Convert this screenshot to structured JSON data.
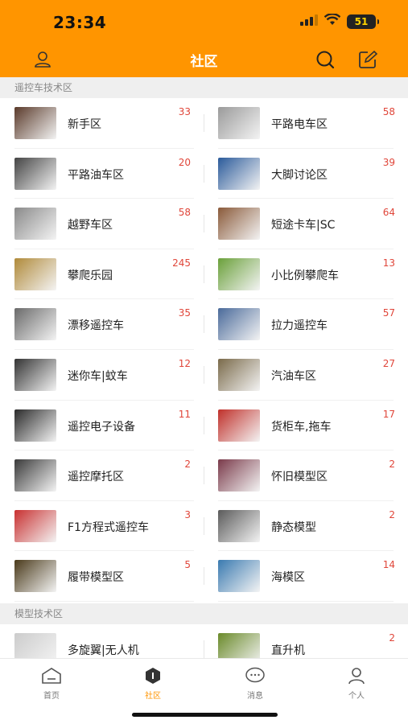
{
  "status_bar": {
    "time": "23:34",
    "battery": "51"
  },
  "nav": {
    "title": "社区"
  },
  "sections": [
    {
      "title": "遥控车技术区",
      "items": [
        {
          "label": "新手区",
          "count": "33",
          "thumb": "#5a3a2a"
        },
        {
          "label": "平路电车区",
          "count": "58",
          "thumb": "#9a9a9a"
        },
        {
          "label": "平路油车区",
          "count": "20",
          "thumb": "#444444"
        },
        {
          "label": "大脚讨论区",
          "count": "39",
          "thumb": "#2a5a9a"
        },
        {
          "label": "越野车区",
          "count": "58",
          "thumb": "#8a8a8a"
        },
        {
          "label": "短途卡车|SC",
          "count": "64",
          "thumb": "#8a5a3a"
        },
        {
          "label": "攀爬乐园",
          "count": "245",
          "thumb": "#b08a3a"
        },
        {
          "label": "小比例攀爬车",
          "count": "13",
          "thumb": "#6aa03a"
        },
        {
          "label": "漂移遥控车",
          "count": "35",
          "thumb": "#6a6a6a"
        },
        {
          "label": "拉力遥控车",
          "count": "57",
          "thumb": "#4a6a9a"
        },
        {
          "label": "迷你车|蚊车",
          "count": "12",
          "thumb": "#333333"
        },
        {
          "label": "汽油车区",
          "count": "27",
          "thumb": "#7a6a4a"
        },
        {
          "label": "遥控电子设备",
          "count": "11",
          "thumb": "#2a2a2a"
        },
        {
          "label": "货柜车,拖车",
          "count": "17",
          "thumb": "#c0302a"
        },
        {
          "label": "遥控摩托区",
          "count": "2",
          "thumb": "#3a3a3a"
        },
        {
          "label": "怀旧模型区",
          "count": "2",
          "thumb": "#7a3a4a"
        },
        {
          "label": "F1方程式遥控车",
          "count": "3",
          "thumb": "#c83030"
        },
        {
          "label": "静态模型",
          "count": "2",
          "thumb": "#5a5a5a"
        },
        {
          "label": "履带模型区",
          "count": "5",
          "thumb": "#4a3a1a"
        },
        {
          "label": "海模区",
          "count": "14",
          "thumb": "#3a7ab0"
        }
      ]
    },
    {
      "title": "模型技术区",
      "items": [
        {
          "label": "多旋翼|无人机",
          "count": "",
          "thumb": "#cccccc"
        },
        {
          "label": "直升机",
          "count": "2",
          "thumb": "#6a8a2a"
        }
      ]
    }
  ],
  "tabs": [
    {
      "label": "首页",
      "icon": "home-icon"
    },
    {
      "label": "社区",
      "icon": "community-icon"
    },
    {
      "label": "消息",
      "icon": "message-icon"
    },
    {
      "label": "个人",
      "icon": "person-icon"
    }
  ],
  "colors": {
    "accent": "#ff9500",
    "count": "#e0463a"
  }
}
